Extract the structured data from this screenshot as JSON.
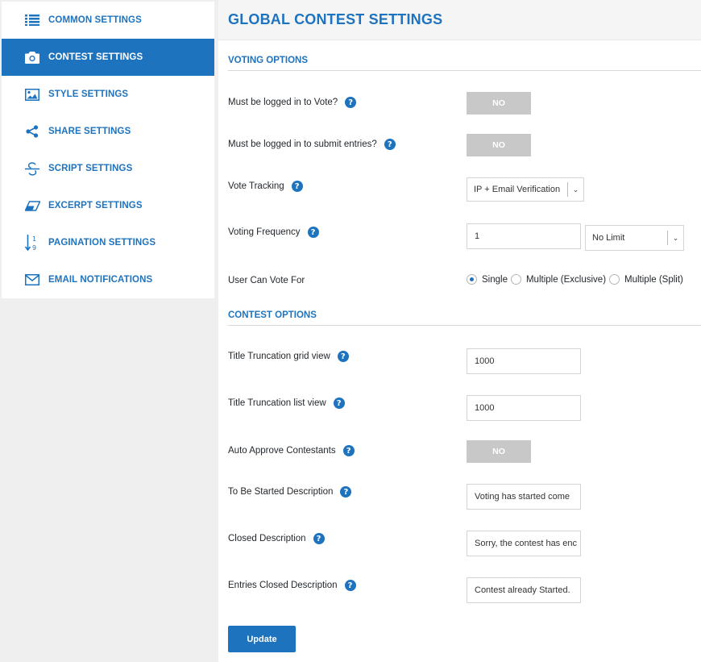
{
  "sidebar": {
    "items": [
      {
        "label": "COMMON SETTINGS",
        "icon": "list-icon"
      },
      {
        "label": "CONTEST SETTINGS",
        "icon": "camera-icon"
      },
      {
        "label": "STYLE SETTINGS",
        "icon": "image-icon"
      },
      {
        "label": "SHARE SETTINGS",
        "icon": "share-icon"
      },
      {
        "label": "SCRIPT SETTINGS",
        "icon": "strikethrough-icon"
      },
      {
        "label": "EXCERPT SETTINGS",
        "icon": "eraser-icon"
      },
      {
        "label": "PAGINATION SETTINGS",
        "icon": "sort-numeric-icon"
      },
      {
        "label": "EMAIL NOTIFICATIONS",
        "icon": "envelope-icon"
      }
    ],
    "active_index": 1
  },
  "header": {
    "title": "GLOBAL CONTEST SETTINGS"
  },
  "voting": {
    "section_title": "VOTING OPTIONS",
    "login_vote": {
      "label": "Must be logged in to Vote?",
      "value": "NO"
    },
    "login_submit": {
      "label": "Must be logged in to submit entries?",
      "value": "NO"
    },
    "vote_tracking": {
      "label": "Vote Tracking",
      "selected": "IP + Email Verification"
    },
    "voting_frequency": {
      "label": "Voting Frequency",
      "value": "1",
      "selected": "No Limit"
    },
    "user_can_vote": {
      "label": "User Can Vote For",
      "options": [
        "Single",
        "Multiple (Exclusive)",
        "Multiple (Split)"
      ],
      "selected": "Single"
    }
  },
  "contest": {
    "section_title": "CONTEST OPTIONS",
    "title_grid": {
      "label": "Title Truncation grid view",
      "value": "1000"
    },
    "title_list": {
      "label": "Title Truncation list view",
      "value": "1000"
    },
    "auto_approve": {
      "label": "Auto Approve Contestants",
      "value": "NO"
    },
    "to_be_started": {
      "label": "To Be Started Description",
      "value": "Voting has started come"
    },
    "closed": {
      "label": "Closed Description",
      "value": "Sorry, the contest has enc"
    },
    "entries_closed": {
      "label": "Entries Closed Description",
      "value": "Contest already Started."
    }
  },
  "update_button": "Update",
  "colors": {
    "accent": "#1e73be",
    "toggle_off": "#c8c8c8",
    "background": "#efefef"
  }
}
